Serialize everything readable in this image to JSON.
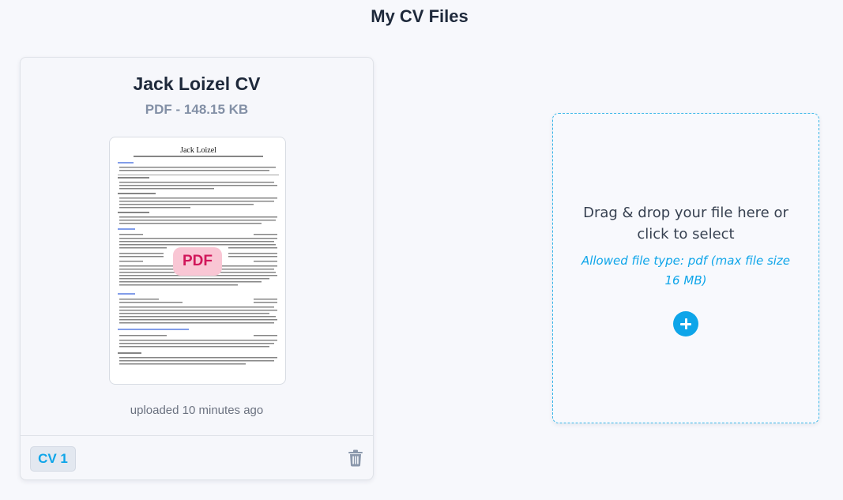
{
  "page": {
    "title": "My CV Files"
  },
  "cv_card": {
    "title": "Jack Loizel CV",
    "meta": "PDF - 148.15 KB",
    "preview": {
      "name": "Jack Loizel",
      "badge": "PDF"
    },
    "uploaded": "uploaded 10 minutes ago",
    "tag": "CV 1",
    "delete_icon": "trash-icon"
  },
  "dropzone": {
    "text": "Drag & drop your file here or click to select",
    "allowed": "Allowed file type: pdf (max file size 16 MB)",
    "add_icon": "plus-icon"
  },
  "colors": {
    "accent": "#0ea5e9",
    "pdf_badge_bg": "#f9c6d4",
    "pdf_badge_text": "#d1165a"
  }
}
